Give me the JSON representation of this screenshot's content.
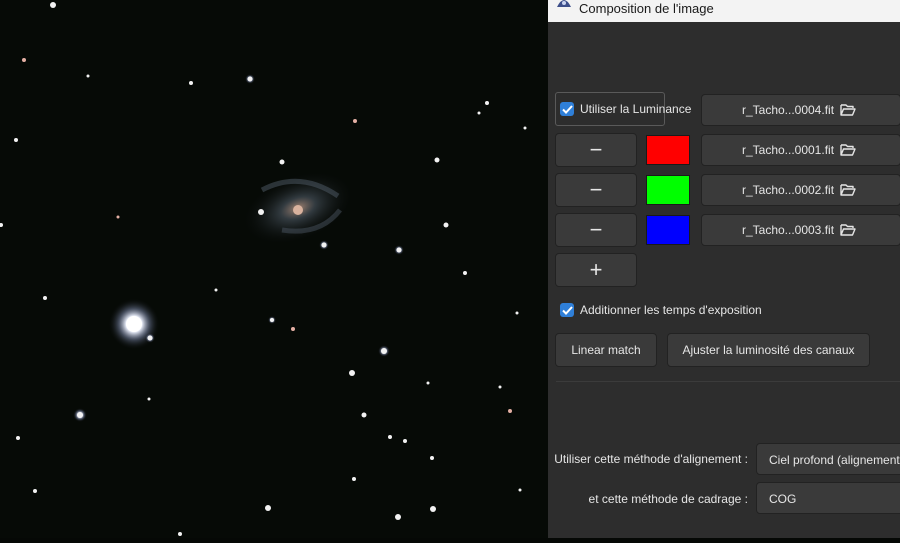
{
  "window": {
    "title": "Composition de l'image"
  },
  "luminance": {
    "label": "Utiliser la Luminance",
    "checked": true,
    "file": "r_Tacho...0004.fit"
  },
  "channels": [
    {
      "remove_label": "−",
      "color": "#ff0000",
      "file": "r_Tacho...0001.fit"
    },
    {
      "remove_label": "−",
      "color": "#00ff00",
      "file": "r_Tacho...0002.fit"
    },
    {
      "remove_label": "−",
      "color": "#0000ff",
      "file": "r_Tacho...0003.fit"
    }
  ],
  "add_label": "+",
  "sum_exposure": {
    "label": "Additionner les temps d'exposition",
    "checked": true
  },
  "actions": {
    "linear_match": "Linear match",
    "adjust_brightness": "Ajuster la luminosité des canaux"
  },
  "alignment": {
    "label": "Utiliser cette méthode d'alignement :",
    "value": "Ciel profond (alignement"
  },
  "framing": {
    "label": "et cette méthode de cadrage :",
    "value": "COG"
  },
  "icons": {
    "folder": "folder-open-icon",
    "check": "check-icon",
    "app": "siril-icon"
  }
}
